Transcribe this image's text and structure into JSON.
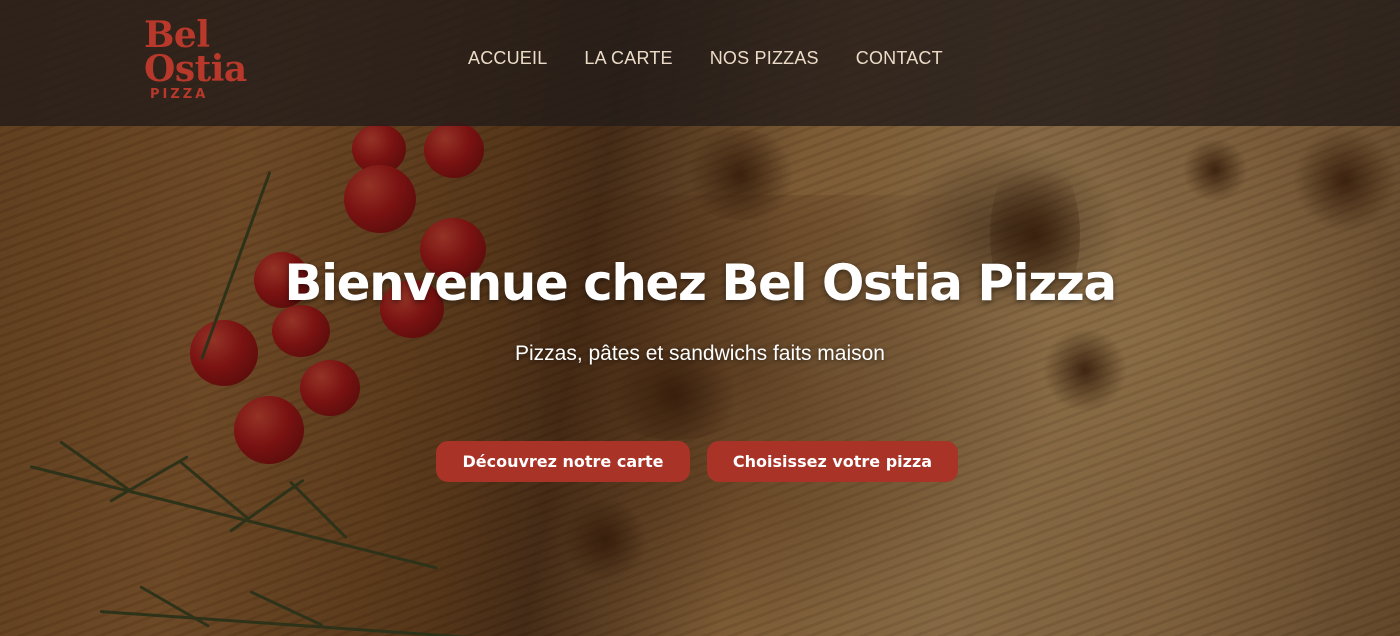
{
  "brand": {
    "logo_line1": "Bel",
    "logo_line2": "Ostia",
    "logo_sub": "PIZZA",
    "accent_color": "#b8392b"
  },
  "nav": {
    "items": [
      {
        "label": "ACCUEIL"
      },
      {
        "label": "LA CARTE"
      },
      {
        "label": "NOS PIZZAS"
      },
      {
        "label": "CONTACT"
      }
    ]
  },
  "hero": {
    "title": "Bienvenue chez Bel Ostia Pizza",
    "subtitle": "Pizzas, pâtes et sandwichs faits maison",
    "button_carte": "Découvrez notre carte",
    "button_pizza": "Choisissez votre pizza",
    "button_color": "#a83326",
    "background": "pizza-photo-background"
  }
}
